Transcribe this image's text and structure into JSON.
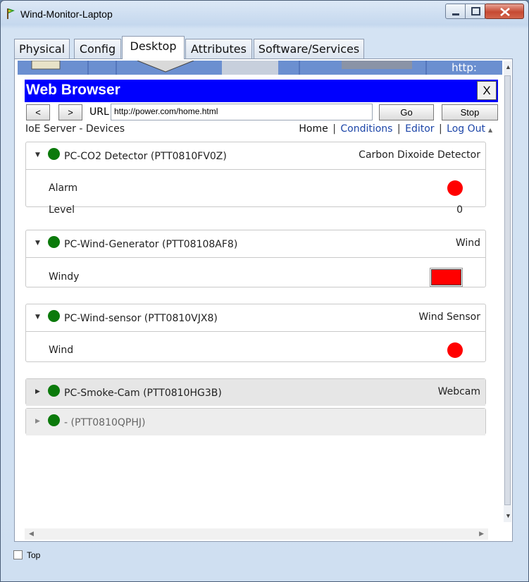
{
  "window": {
    "title": "Wind-Monitor-Laptop"
  },
  "tabs": [
    {
      "label": "Physical"
    },
    {
      "label": "Config"
    },
    {
      "label": "Desktop"
    },
    {
      "label": "Attributes"
    },
    {
      "label": "Software/Services"
    }
  ],
  "background": {
    "partial_url": "http:"
  },
  "browser": {
    "title": "Web Browser",
    "close_label": "X",
    "back_label": "<",
    "forward_label": ">",
    "url_label": "URL",
    "url_value": "http://power.com/home.html",
    "go_label": "Go",
    "stop_label": "Stop"
  },
  "page": {
    "server_label": "IoE Server - Devices",
    "nav": {
      "home": "Home",
      "conditions": "Conditions",
      "editor": "Editor",
      "logout": "Log Out",
      "separator": "|"
    }
  },
  "devices": [
    {
      "name": "PC-CO2 Detector (PTT0810FV0Z)",
      "type": "Carbon Dixoide Detector",
      "status_color": "#0b7a0b",
      "expanded": true,
      "attributes": [
        {
          "label": "Alarm",
          "indicator": "red-dot",
          "color": "#ff0000"
        },
        {
          "label": "Level",
          "value": "0"
        }
      ]
    },
    {
      "name": "PC-Wind-Generator (PTT08108AF8)",
      "type": "Wind",
      "status_color": "#0b7a0b",
      "expanded": true,
      "attributes": [
        {
          "label": "Windy",
          "indicator": "red-box",
          "color": "#ff0000"
        }
      ]
    },
    {
      "name": "PC-Wind-sensor (PTT0810VJX8)",
      "type": "Wind Sensor",
      "status_color": "#0b7a0b",
      "expanded": true,
      "attributes": [
        {
          "label": "Wind",
          "indicator": "red-dot",
          "color": "#ff0000"
        }
      ]
    },
    {
      "name": "PC-Smoke-Cam (PTT0810HG3B)",
      "type": "Webcam",
      "status_color": "#0b7a0b",
      "expanded": false
    },
    {
      "name": "- (PTT0810QPHJ)",
      "type": "",
      "status_color": "#0b7a0b",
      "expanded": false
    }
  ],
  "footer": {
    "top_label": "Top",
    "top_checked": false
  }
}
